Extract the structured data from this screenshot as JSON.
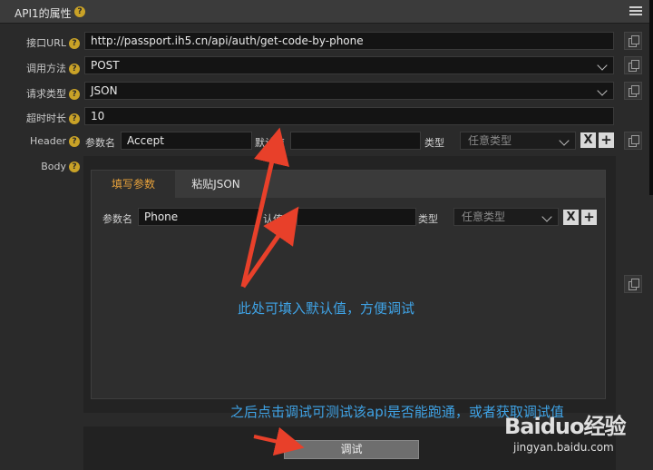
{
  "panel": {
    "title": "API1的属性",
    "help": "?"
  },
  "url": {
    "label": "接口URL",
    "value": "http://passport.ih5.cn/api/auth/get-code-by-phone"
  },
  "method": {
    "label": "调用方法",
    "value": "POST"
  },
  "reqtype": {
    "label": "请求类型",
    "value": "JSON"
  },
  "timeout": {
    "label": "超时时长",
    "value": "10"
  },
  "header": {
    "label": "Header",
    "param_label": "参数名",
    "param_value": "Accept",
    "default_label": "默认值",
    "default_value": "",
    "type_label": "类型",
    "type_placeholder": "任意类型",
    "remove": "X",
    "add": "+"
  },
  "body": {
    "label": "Body",
    "tabs": [
      "填写参数",
      "粘贴JSON"
    ],
    "param_label": "参数名",
    "param_value": "Phone",
    "default_label": "认值",
    "default_value": "",
    "type_label": "类型",
    "type_placeholder": "任意类型",
    "remove": "X",
    "add": "+"
  },
  "debug_button": "调试",
  "annotations": {
    "note1": "此处可填入默认值，方便调试",
    "note2": "之后点击调试可测试该api是否能跑通，或者获取调试值"
  },
  "watermark": {
    "logo": "Baiduo经验",
    "url": "jingyan.baidu.com"
  },
  "colors": {
    "accent": "#e8a23b",
    "annotation": "#3fa3e6",
    "arrow": "#e8402a",
    "help": "#c9a227"
  }
}
